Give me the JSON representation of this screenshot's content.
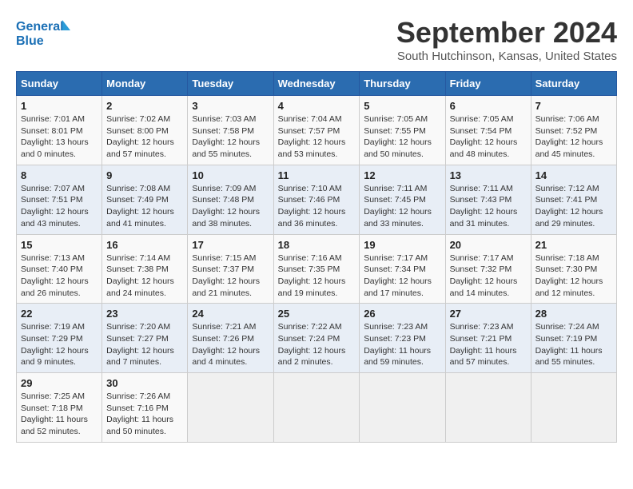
{
  "logo": {
    "line1": "General",
    "line2": "Blue"
  },
  "title": "September 2024",
  "location": "South Hutchinson, Kansas, United States",
  "weekdays": [
    "Sunday",
    "Monday",
    "Tuesday",
    "Wednesday",
    "Thursday",
    "Friday",
    "Saturday"
  ],
  "weeks": [
    [
      {
        "day": "1",
        "info": "Sunrise: 7:01 AM\nSunset: 8:01 PM\nDaylight: 13 hours\nand 0 minutes."
      },
      {
        "day": "2",
        "info": "Sunrise: 7:02 AM\nSunset: 8:00 PM\nDaylight: 12 hours\nand 57 minutes."
      },
      {
        "day": "3",
        "info": "Sunrise: 7:03 AM\nSunset: 7:58 PM\nDaylight: 12 hours\nand 55 minutes."
      },
      {
        "day": "4",
        "info": "Sunrise: 7:04 AM\nSunset: 7:57 PM\nDaylight: 12 hours\nand 53 minutes."
      },
      {
        "day": "5",
        "info": "Sunrise: 7:05 AM\nSunset: 7:55 PM\nDaylight: 12 hours\nand 50 minutes."
      },
      {
        "day": "6",
        "info": "Sunrise: 7:05 AM\nSunset: 7:54 PM\nDaylight: 12 hours\nand 48 minutes."
      },
      {
        "day": "7",
        "info": "Sunrise: 7:06 AM\nSunset: 7:52 PM\nDaylight: 12 hours\nand 45 minutes."
      }
    ],
    [
      {
        "day": "8",
        "info": "Sunrise: 7:07 AM\nSunset: 7:51 PM\nDaylight: 12 hours\nand 43 minutes."
      },
      {
        "day": "9",
        "info": "Sunrise: 7:08 AM\nSunset: 7:49 PM\nDaylight: 12 hours\nand 41 minutes."
      },
      {
        "day": "10",
        "info": "Sunrise: 7:09 AM\nSunset: 7:48 PM\nDaylight: 12 hours\nand 38 minutes."
      },
      {
        "day": "11",
        "info": "Sunrise: 7:10 AM\nSunset: 7:46 PM\nDaylight: 12 hours\nand 36 minutes."
      },
      {
        "day": "12",
        "info": "Sunrise: 7:11 AM\nSunset: 7:45 PM\nDaylight: 12 hours\nand 33 minutes."
      },
      {
        "day": "13",
        "info": "Sunrise: 7:11 AM\nSunset: 7:43 PM\nDaylight: 12 hours\nand 31 minutes."
      },
      {
        "day": "14",
        "info": "Sunrise: 7:12 AM\nSunset: 7:41 PM\nDaylight: 12 hours\nand 29 minutes."
      }
    ],
    [
      {
        "day": "15",
        "info": "Sunrise: 7:13 AM\nSunset: 7:40 PM\nDaylight: 12 hours\nand 26 minutes."
      },
      {
        "day": "16",
        "info": "Sunrise: 7:14 AM\nSunset: 7:38 PM\nDaylight: 12 hours\nand 24 minutes."
      },
      {
        "day": "17",
        "info": "Sunrise: 7:15 AM\nSunset: 7:37 PM\nDaylight: 12 hours\nand 21 minutes."
      },
      {
        "day": "18",
        "info": "Sunrise: 7:16 AM\nSunset: 7:35 PM\nDaylight: 12 hours\nand 19 minutes."
      },
      {
        "day": "19",
        "info": "Sunrise: 7:17 AM\nSunset: 7:34 PM\nDaylight: 12 hours\nand 17 minutes."
      },
      {
        "day": "20",
        "info": "Sunrise: 7:17 AM\nSunset: 7:32 PM\nDaylight: 12 hours\nand 14 minutes."
      },
      {
        "day": "21",
        "info": "Sunrise: 7:18 AM\nSunset: 7:30 PM\nDaylight: 12 hours\nand 12 minutes."
      }
    ],
    [
      {
        "day": "22",
        "info": "Sunrise: 7:19 AM\nSunset: 7:29 PM\nDaylight: 12 hours\nand 9 minutes."
      },
      {
        "day": "23",
        "info": "Sunrise: 7:20 AM\nSunset: 7:27 PM\nDaylight: 12 hours\nand 7 minutes."
      },
      {
        "day": "24",
        "info": "Sunrise: 7:21 AM\nSunset: 7:26 PM\nDaylight: 12 hours\nand 4 minutes."
      },
      {
        "day": "25",
        "info": "Sunrise: 7:22 AM\nSunset: 7:24 PM\nDaylight: 12 hours\nand 2 minutes."
      },
      {
        "day": "26",
        "info": "Sunrise: 7:23 AM\nSunset: 7:23 PM\nDaylight: 11 hours\nand 59 minutes."
      },
      {
        "day": "27",
        "info": "Sunrise: 7:23 AM\nSunset: 7:21 PM\nDaylight: 11 hours\nand 57 minutes."
      },
      {
        "day": "28",
        "info": "Sunrise: 7:24 AM\nSunset: 7:19 PM\nDaylight: 11 hours\nand 55 minutes."
      }
    ],
    [
      {
        "day": "29",
        "info": "Sunrise: 7:25 AM\nSunset: 7:18 PM\nDaylight: 11 hours\nand 52 minutes."
      },
      {
        "day": "30",
        "info": "Sunrise: 7:26 AM\nSunset: 7:16 PM\nDaylight: 11 hours\nand 50 minutes."
      },
      {
        "day": "",
        "info": ""
      },
      {
        "day": "",
        "info": ""
      },
      {
        "day": "",
        "info": ""
      },
      {
        "day": "",
        "info": ""
      },
      {
        "day": "",
        "info": ""
      }
    ]
  ]
}
